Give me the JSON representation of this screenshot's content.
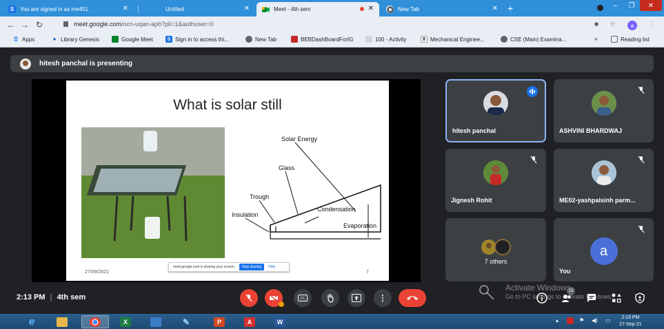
{
  "browser": {
    "tabs": [
      {
        "label": "You are signed in as me451",
        "favicon": "S"
      },
      {
        "label": "Untitled",
        "favicon": ""
      },
      {
        "label": "Meet - 4th sem",
        "favicon": "meet"
      },
      {
        "label": "New Tab",
        "favicon": "chrome"
      }
    ],
    "new_tab_symbol": "+",
    "url_host": "meet.google.com",
    "url_path": "/ocn-uqan-apb?pli=1&authuser=0",
    "profile_initial": "a",
    "bookmarks": [
      {
        "label": "Apps"
      },
      {
        "label": "Library Genesis"
      },
      {
        "label": "Google Meet"
      },
      {
        "label": "Sign in to access thi..."
      },
      {
        "label": "New Tab"
      },
      {
        "label": "BEBDashBoardForIG"
      },
      {
        "label": "100 - Activity"
      },
      {
        "label": "Mechanical Enginee..."
      },
      {
        "label": "CSE (Main) Examina..."
      }
    ],
    "more_bookmarks": "»",
    "reading_list": "Reading list"
  },
  "meet": {
    "presenting_text": "hitesh panchal is presenting",
    "slide": {
      "title": "What is solar still",
      "labels": {
        "solar_energy": "Solar Energy",
        "glass": "Glass",
        "trough": "Trough",
        "insulation": "Insulation",
        "condensation": "Condensation",
        "evaporation": "Evaporation"
      },
      "date": "27/09/2021",
      "page": "7",
      "share_text": "meet.google.com is sharing your screen.",
      "stop_sharing": "Stop sharing",
      "hide": "Hide"
    },
    "tiles": [
      {
        "name": "hitesh panchal",
        "speaking": true
      },
      {
        "name": "ASHVINI BHARDWAJ",
        "muted": true
      },
      {
        "name": "Jignesh Rohit",
        "muted": true
      },
      {
        "name": "ME02-yashpalsinh parm...",
        "muted": true
      },
      {
        "name": "7 others"
      },
      {
        "name": "You",
        "initial": "a",
        "muted": true
      }
    ],
    "time": "2:13 PM",
    "separator": "|",
    "meeting_name": "4th sem",
    "participant_count": "13",
    "watermark_title": "Activate Windows",
    "watermark_sub": "Go to PC settings to activate Windows."
  },
  "taskbar": {
    "time": "2:13 PM",
    "date": "27-Sep-21"
  },
  "colors": {
    "tab_strip": "#2f8fd8",
    "meet_bg": "#202124",
    "tile_bg": "#3c4043",
    "red": "#ea4335",
    "active_border": "#8ab4f8"
  }
}
